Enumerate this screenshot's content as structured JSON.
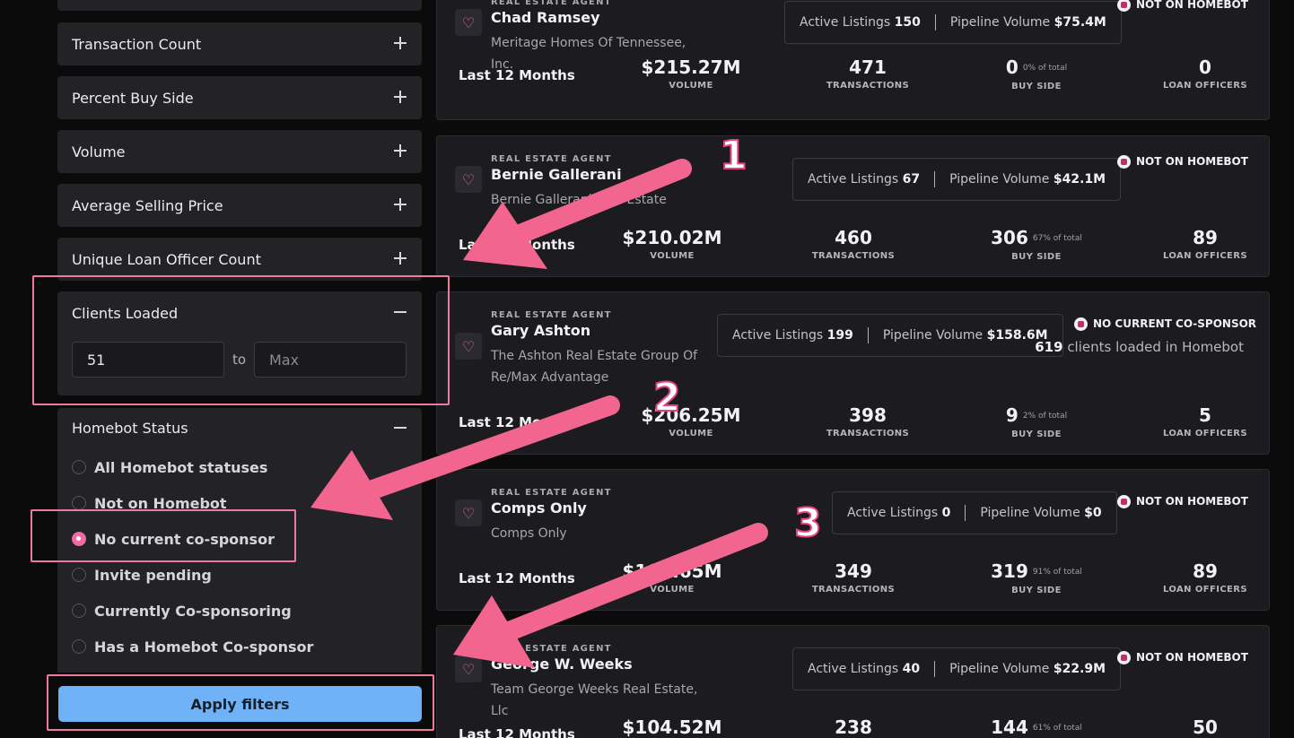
{
  "sidebar": {
    "filters_collapsed": [
      {
        "label": "Transaction Count"
      },
      {
        "label": "Percent Buy Side"
      },
      {
        "label": "Volume"
      },
      {
        "label": "Average Selling Price"
      },
      {
        "label": "Unique Loan Officer Count"
      }
    ],
    "clients_loaded": {
      "label": "Clients Loaded",
      "min_value": "51",
      "to_label": "to",
      "max_placeholder": "Max"
    },
    "homebot_status": {
      "label": "Homebot Status",
      "options": [
        {
          "label": "All Homebot statuses",
          "selected": false
        },
        {
          "label": "Not on Homebot",
          "selected": false
        },
        {
          "label": "No current co-sponsor",
          "selected": true
        },
        {
          "label": "Invite pending",
          "selected": false
        },
        {
          "label": "Currently Co-sponsoring",
          "selected": false
        },
        {
          "label": "Has a Homebot Co-sponsor",
          "selected": false
        }
      ]
    },
    "apply_label": "Apply filters"
  },
  "stat_labels": {
    "period": "Last 12 Months",
    "volume": "VOLUME",
    "transactions": "TRANSACTIONS",
    "buy_side": "BUY SIDE",
    "loan_officers": "LOAN OFFICERS",
    "active_listings": "Active Listings",
    "pipeline_volume": "Pipeline Volume"
  },
  "agents": [
    {
      "role": "REAL ESTATE AGENT",
      "name": "Chad Ramsey",
      "company": "Meritage Homes Of Tennessee, Inc.",
      "active_listings": "150",
      "pipeline_volume": "$75.4M",
      "status": "NOT ON HOMEBOT",
      "volume": "$215.27M",
      "transactions": "471",
      "buy_side": "0",
      "buy_side_pct": "0% of total",
      "loan_officers": "0"
    },
    {
      "role": "REAL ESTATE AGENT",
      "name": "Bernie Gallerani",
      "company": "Bernie Gallerani Real Estate",
      "active_listings": "67",
      "pipeline_volume": "$42.1M",
      "status": "NOT ON HOMEBOT",
      "volume": "$210.02M",
      "transactions": "460",
      "buy_side": "306",
      "buy_side_pct": "67% of total",
      "loan_officers": "89"
    },
    {
      "role": "REAL ESTATE AGENT",
      "name": "Gary Ashton",
      "company": "The Ashton Real Estate Group Of Re/Max Advantage",
      "active_listings": "199",
      "pipeline_volume": "$158.6M",
      "status": "NO CURRENT CO-SPONSOR",
      "clients_count": "619",
      "clients_text": "clients loaded in Homebot",
      "volume": "$206.25M",
      "transactions": "398",
      "buy_side": "9",
      "buy_side_pct": "2% of total",
      "loan_officers": "5"
    },
    {
      "role": "REAL ESTATE AGENT",
      "name": "Comps Only",
      "company": "Comps Only",
      "active_listings": "0",
      "pipeline_volume": "$0",
      "status": "NOT ON HOMEBOT",
      "volume": "$105.65M",
      "transactions": "349",
      "buy_side": "319",
      "buy_side_pct": "91% of total",
      "loan_officers": "89"
    },
    {
      "role": "REAL ESTATE AGENT",
      "name": "George W. Weeks",
      "company": "Team George Weeks Real Estate, Llc",
      "active_listings": "40",
      "pipeline_volume": "$22.9M",
      "status": "NOT ON HOMEBOT",
      "volume": "$104.52M",
      "transactions": "238",
      "buy_side": "144",
      "buy_side_pct": "61% of total",
      "loan_officers": "50"
    }
  ],
  "annotations": {
    "step1": "1",
    "step2": "2",
    "step3": "3",
    "color": "#f2658f"
  }
}
